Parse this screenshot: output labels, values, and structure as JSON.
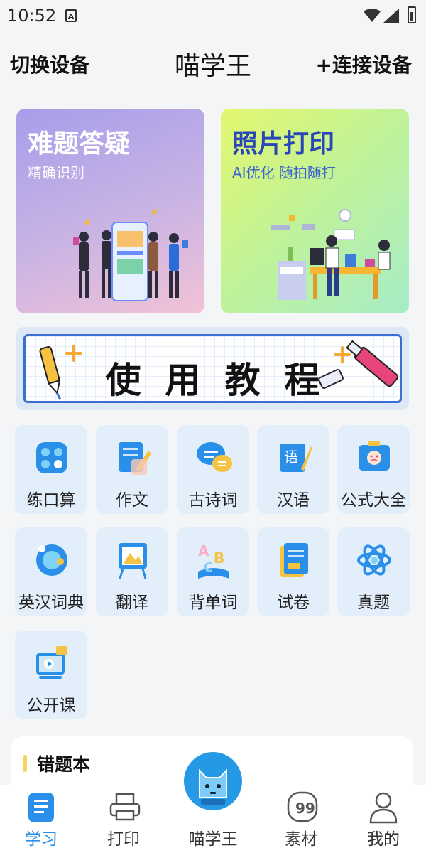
{
  "status_bar": {
    "time": "10:52",
    "notification_icon": "A"
  },
  "header": {
    "left_action": "切换设备",
    "title": "喵学王",
    "right_action": "+连接设备"
  },
  "cards": [
    {
      "title": "难题答疑",
      "subtitle": "精确识别"
    },
    {
      "title": "照片打印",
      "subtitle": "AI优化 随拍随打"
    }
  ],
  "tutorial": {
    "label": "使用教程"
  },
  "grid": [
    {
      "label": "练口算",
      "icon": "calculator-icon"
    },
    {
      "label": "作文",
      "icon": "notebook-pen-icon"
    },
    {
      "label": "古诗词",
      "icon": "chat-bubbles-icon"
    },
    {
      "label": "汉语",
      "icon": "chinese-book-icon"
    },
    {
      "label": "公式大全",
      "icon": "formula-card-icon"
    },
    {
      "label": "英汉词典",
      "icon": "globe-icon"
    },
    {
      "label": "翻译",
      "icon": "easel-icon"
    },
    {
      "label": "背单词",
      "icon": "abc-book-icon"
    },
    {
      "label": "试卷",
      "icon": "exam-paper-icon"
    },
    {
      "label": "真题",
      "icon": "atom-icon"
    },
    {
      "label": "公开课",
      "icon": "video-lesson-icon"
    }
  ],
  "wrong_book": {
    "title": "错题本"
  },
  "bottom_nav": [
    {
      "label": "学习",
      "icon": "study-icon",
      "active": true
    },
    {
      "label": "打印",
      "icon": "printer-icon",
      "active": false
    },
    {
      "label": "喵学王",
      "icon": "cat-icon",
      "active": false
    },
    {
      "label": "素材",
      "icon": "quote-icon",
      "active": false
    },
    {
      "label": "我的",
      "icon": "user-icon",
      "active": false
    }
  ],
  "colors": {
    "accent": "#2a8fe8",
    "tile_bg": "#e3eefb",
    "print_title": "#2a47b8"
  }
}
